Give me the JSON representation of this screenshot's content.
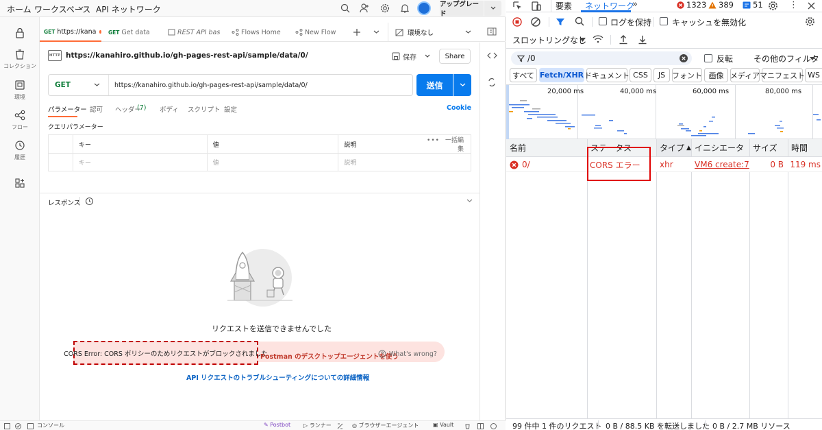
{
  "postman": {
    "nav": {
      "home": "ホーム",
      "workspaces": "ワークスペース",
      "api_network": "API ネットワーク",
      "upgrade": "アップグレード"
    },
    "sidebar": [
      {
        "label": "コレクション",
        "icon": "trash-icon"
      },
      {
        "label": "環境",
        "icon": "environment-icon"
      },
      {
        "label": "フロー",
        "icon": "flow-icon"
      },
      {
        "label": "履歴",
        "icon": "history-icon"
      }
    ],
    "tabs": [
      {
        "method": "GET",
        "label": "https://kana"
      },
      {
        "method": "GET",
        "label": "Get data"
      },
      {
        "method": "",
        "label": "REST API bas"
      },
      {
        "method": "",
        "label": "Flows Home"
      },
      {
        "method": "",
        "label": "New Flow"
      }
    ],
    "env": "環境なし",
    "request": {
      "title": "https://kanahiro.github.io/gh-pages-rest-api/sample/data/0/",
      "save": "保存",
      "share": "Share",
      "method": "GET",
      "url": "https://kanahiro.github.io/gh-pages-rest-api/sample/data/0/",
      "send": "送信"
    },
    "subtabs": {
      "params": "パラメーター",
      "auth": "認可",
      "headers": "ヘッダー",
      "headers_count": "(7)",
      "body": "ボディ",
      "script": "スクリプト",
      "settings": "設定",
      "cookie": "Cookie"
    },
    "query_title": "クエリパラメーター",
    "table": {
      "key": "キー",
      "value": "値",
      "desc": "説明",
      "bulk": "一括編集",
      "key_ph": "キー",
      "value_ph": "値",
      "desc_ph": "説明"
    },
    "response": {
      "label": "レスポンス",
      "cannot_send": "リクエストを送信できませんでした",
      "cors_error": "CORS Error: CORS ポリシーのためリクエストがブロックされました",
      "agent_link": "Postman のデスクトップエージェントを使う",
      "whats_wrong": "What's wrong?",
      "learn_more": "API リクエストのトラブルシューティングについての詳細情報"
    },
    "statusbar": {
      "console": "コンソール",
      "postbot": "Postbot",
      "runner": "ランナー",
      "browser_agent": "ブラウザーエージェント",
      "vault": "Vault"
    }
  },
  "devtools": {
    "tabs": {
      "elements": "要素",
      "network": "ネットワーク"
    },
    "counts": {
      "errors": "1323",
      "warnings": "389",
      "info": "51"
    },
    "toolbar": {
      "preserve_log": "ログを保持",
      "disable_cache": "キャッシュを無効化",
      "throttle": "スロットリングなし"
    },
    "filter": {
      "value": "/0",
      "invert": "反転",
      "more": "その他のフィルタ"
    },
    "chips": [
      "すべて",
      "Fetch/XHR",
      "ドキュメント",
      "CSS",
      "JS",
      "フォント",
      "画像",
      "メディア",
      "マニフェスト",
      "WS"
    ],
    "timeline": [
      "20,000 ms",
      "40,000 ms",
      "60,000 ms",
      "80,000 ms"
    ],
    "columns": {
      "name": "名前",
      "status": "ステータス",
      "type": "タイプ",
      "initiator": "イニシエータ",
      "size": "サイズ",
      "time": "時間"
    },
    "rows": [
      {
        "name": "0/",
        "status": "CORS エラー",
        "type": "xhr",
        "initiator": "VM6 create:7",
        "size": "0 B",
        "time": "119 ms"
      }
    ],
    "summary": {
      "requests": "99 件中 1 件のリクエスト",
      "transferred": "0 B / 88.5 KB を転送しました",
      "resources": "0 B / 2.7 MB リソース"
    }
  },
  "colors": {
    "accent": "#ff6c37",
    "send_blue": "#097bed",
    "devtools_blue": "#1a73e8",
    "error_red": "#d93025"
  }
}
